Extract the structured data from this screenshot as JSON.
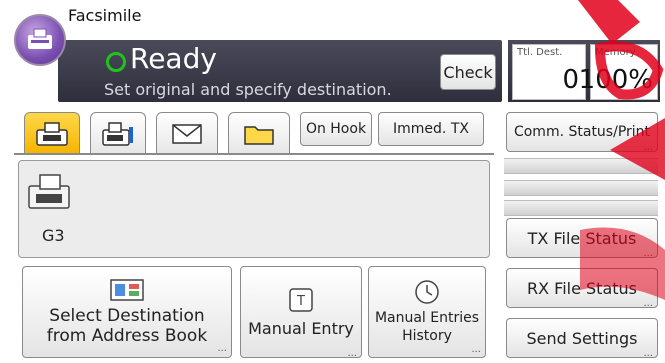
{
  "header": {
    "title": "Facsimile",
    "status": "Ready",
    "message": "Set original and specify destination.",
    "check_label": "Check"
  },
  "counters": {
    "total_dest_label": "Ttl. Dest.",
    "total_dest_value": "0",
    "memory_label": "Memory",
    "memory_value": "100%"
  },
  "tabs": [
    {
      "icon": "fax-icon",
      "active": true
    },
    {
      "icon": "fax-info-icon",
      "active": false
    },
    {
      "icon": "mail-icon",
      "active": false
    },
    {
      "icon": "folder-icon",
      "active": false
    }
  ],
  "toolbar": {
    "on_hook_label": "On Hook",
    "immed_tx_label": "Immed. TX"
  },
  "destination": {
    "line_type": "G3"
  },
  "actions": {
    "select_destination_line1": "Select Destination",
    "select_destination_line2": "from Address Book",
    "manual_entry_label": "Manual Entry",
    "manual_history_line1": "Manual Entries",
    "manual_history_line2": "History"
  },
  "side": {
    "comm_status_label": "Comm. Status/Print",
    "tx_file_status_label": "TX File Status",
    "rx_file_status_label": "RX File Status",
    "send_settings_label": "Send Settings"
  },
  "colors": {
    "header_bg": "#3a3a4a",
    "ready_green": "#22c21e",
    "tab_active": "#f5c000",
    "watermark": "#e0001a"
  }
}
